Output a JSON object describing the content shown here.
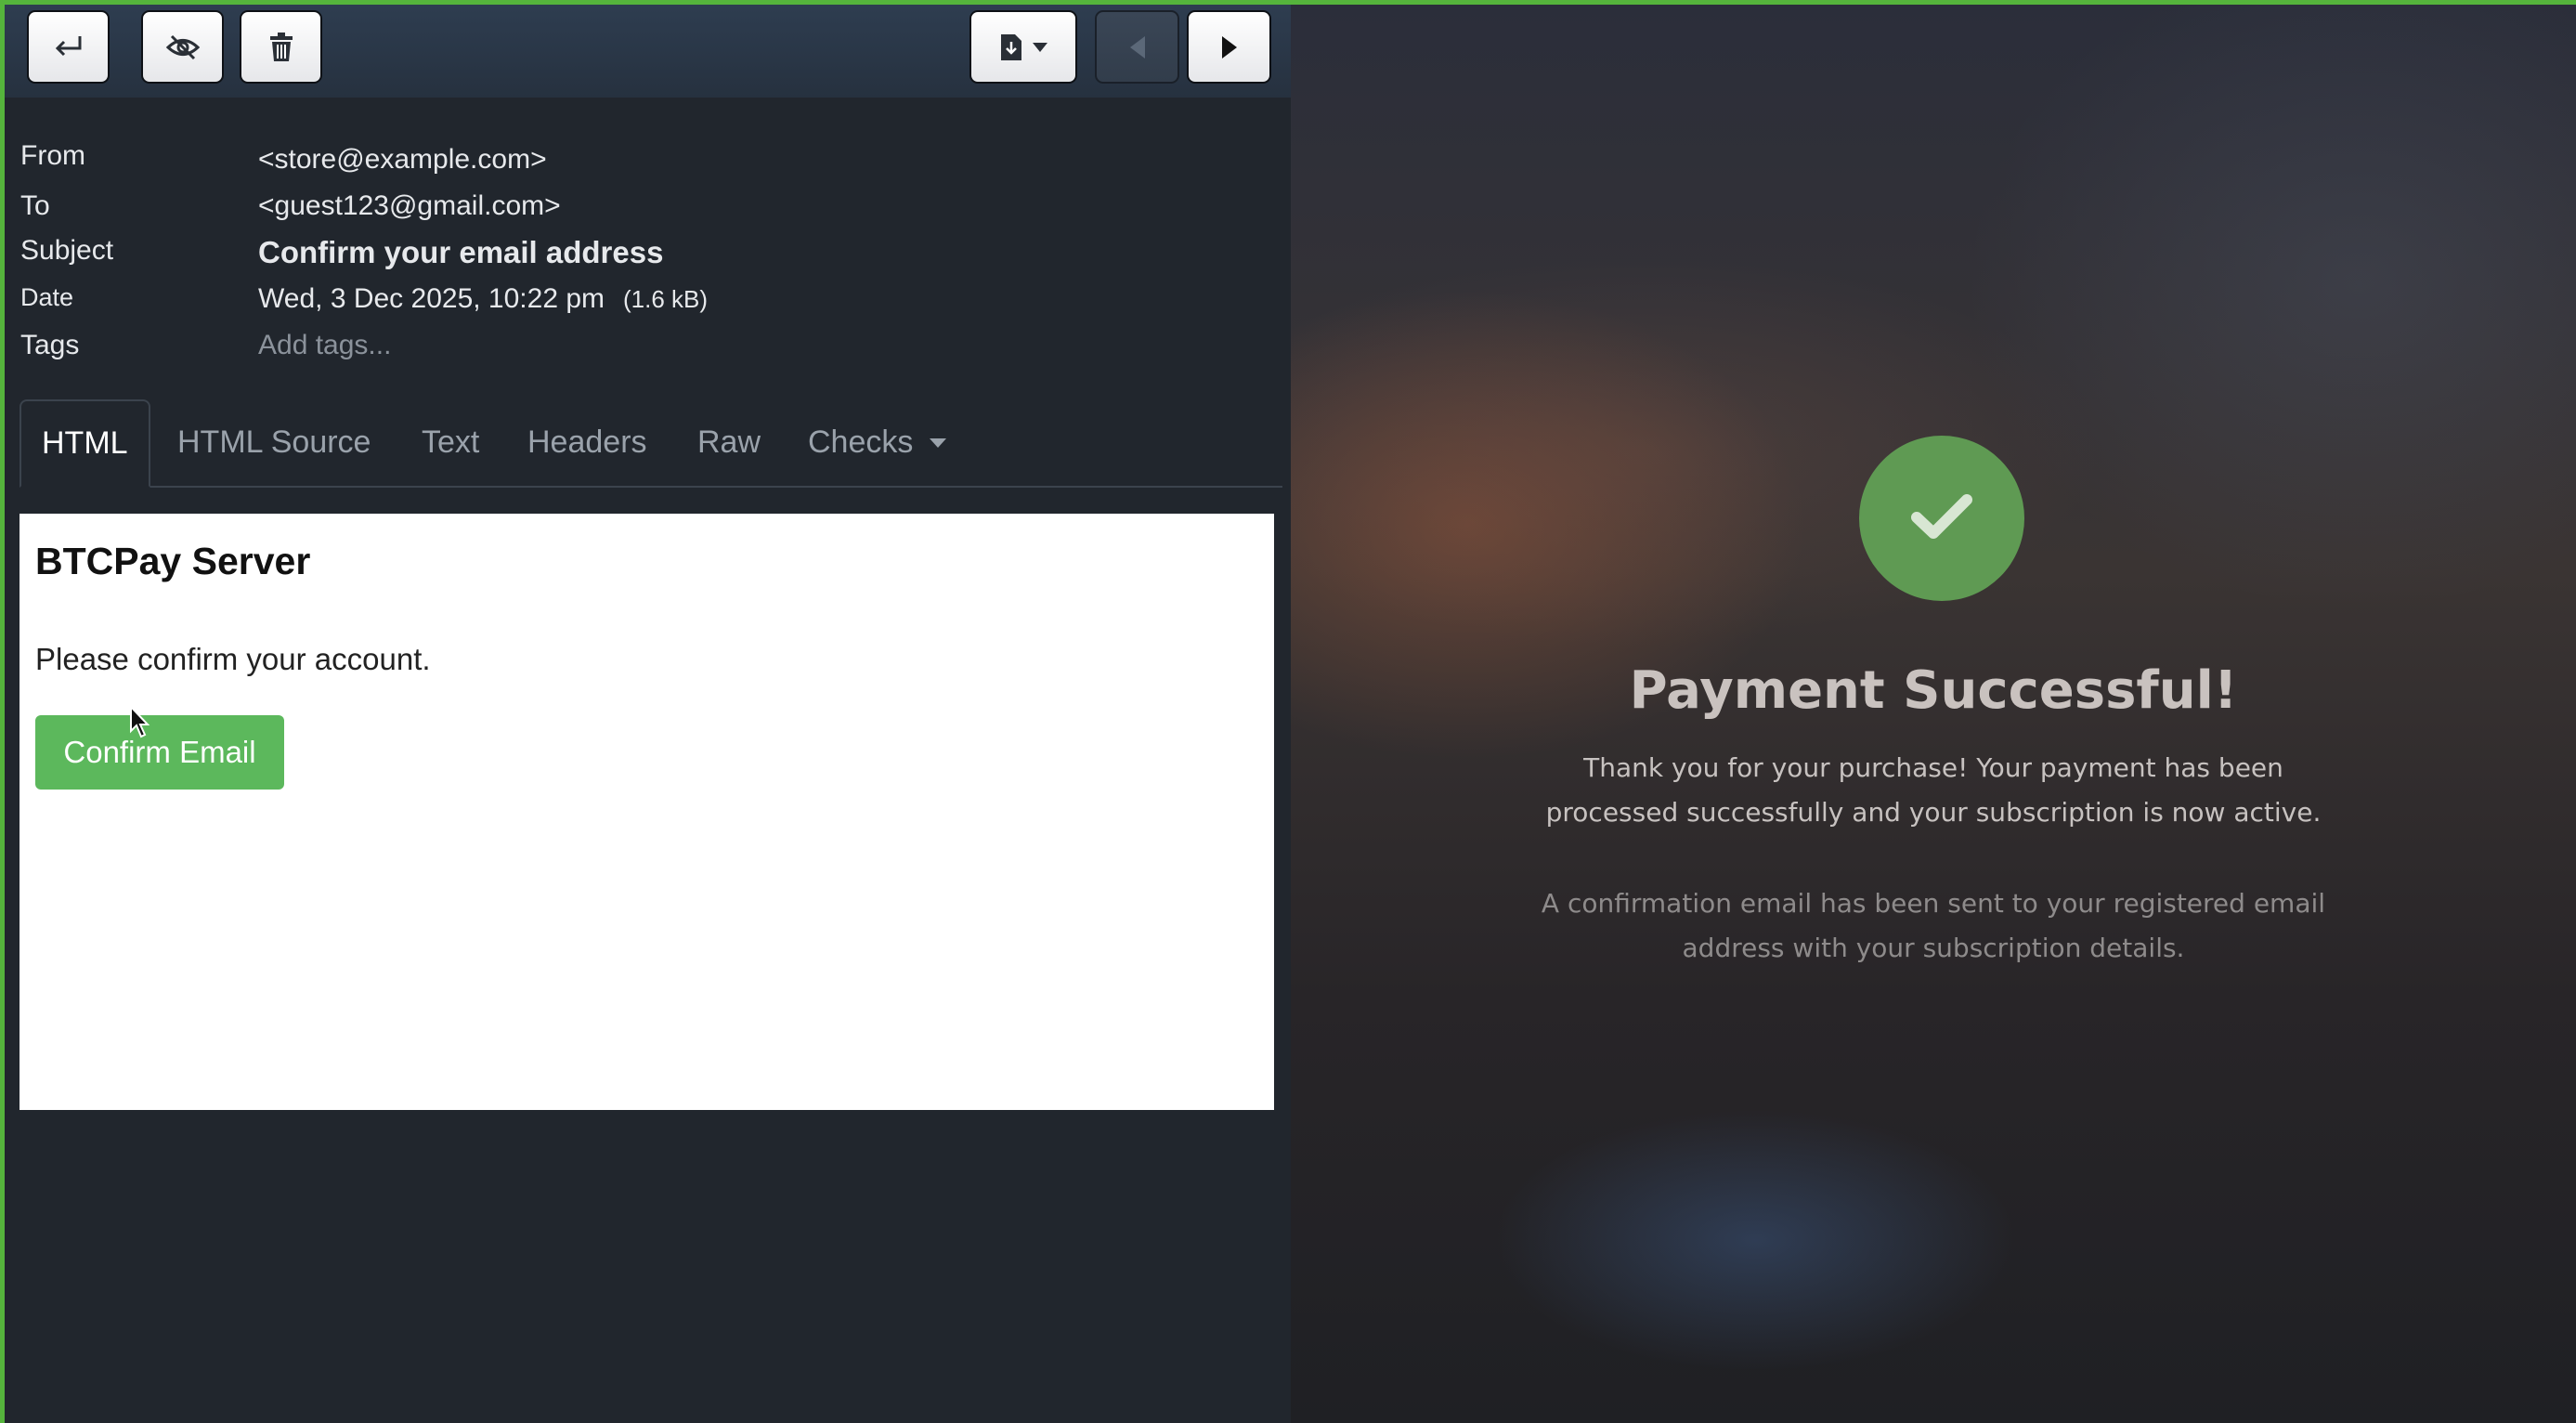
{
  "toolbar": {
    "reply_icon": "return-arrow-icon",
    "hide_icon": "eye-slash-icon",
    "delete_icon": "trash-icon",
    "download_icon": "download-file-icon",
    "prev_icon": "arrow-left-icon",
    "next_icon": "arrow-right-icon"
  },
  "meta": {
    "from_label": "From",
    "from_value": "<store@example.com>",
    "to_label": "To",
    "to_value": "<guest123@gmail.com>",
    "subject_label": "Subject",
    "subject_value": "Confirm your email address",
    "date_label": "Date",
    "date_value": "Wed, 3 Dec 2025, 10:22 pm",
    "size_value": "(1.6 kB)",
    "tags_label": "Tags",
    "tags_placeholder": "Add tags..."
  },
  "tabs": [
    {
      "label": "HTML",
      "active": true
    },
    {
      "label": "HTML Source"
    },
    {
      "label": "Text"
    },
    {
      "label": "Headers"
    },
    {
      "label": "Raw"
    },
    {
      "label": "Checks"
    }
  ],
  "preview": {
    "title": "BTCPay Server",
    "text": "Please confirm your account.",
    "button": "Confirm Email",
    "button_color": "#5cb85c"
  },
  "checkout": {
    "check_icon": "checkmark-icon",
    "title": "Payment Successful!",
    "message": "Thank you for your purchase! Your payment has been processed successfully and your subscription is now active.",
    "note": "A confirmation email has been sent to your registered email address with your subscription details.",
    "success_color": "#5f9a53"
  },
  "colors": {
    "frame_accent": "#55b43c",
    "mail_background": "#21262d"
  }
}
